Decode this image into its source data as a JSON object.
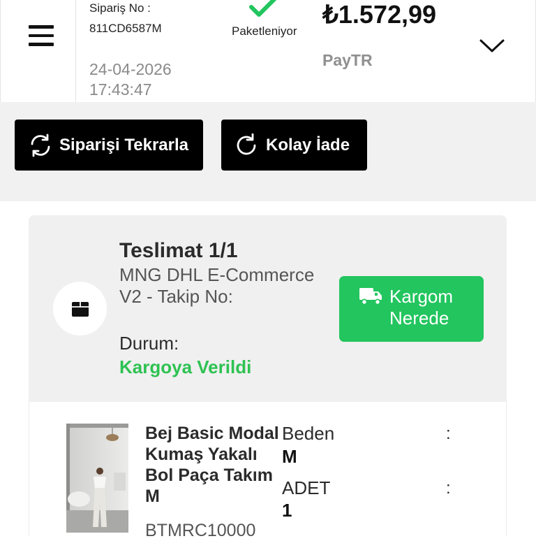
{
  "order": {
    "number_label": "Sipariş No :",
    "number": "811CD6587M",
    "date": "24-04-2026",
    "time": "17:43:47",
    "status": "Paketleniyor",
    "price": "₺1.572,99",
    "payment_method": "PayTR"
  },
  "actions": {
    "repeat_label": "Siparişi Tekrarla",
    "return_label": "Kolay İade"
  },
  "shipment": {
    "title": "Teslimat 1/1",
    "carrier": "MNG DHL E-Commerce V2 - Takip No:",
    "status_label": "Durum:",
    "status_value": "Kargoya Verildi",
    "track_label": "Kargom Nerede"
  },
  "product": {
    "name": "Bej Basic Modal Kumaş Yakalı Bol Paça Takım M",
    "sku": "BTMRC10000",
    "size_label": "Beden",
    "size_value": "M",
    "qty_label": "ADET",
    "qty_value": "1"
  },
  "icons": {
    "menu": "hamburger-icon",
    "status": "check-icon",
    "expand": "chevron-down-icon",
    "repeat": "refresh-icon",
    "return": "redo-icon",
    "package": "box-icon",
    "truck": "truck-icon"
  },
  "colors": {
    "status_green": "#22c55e",
    "button_black": "#000000"
  }
}
